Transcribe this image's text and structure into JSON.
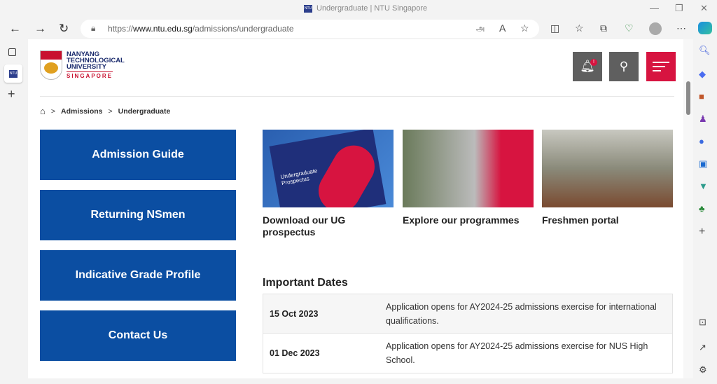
{
  "browser": {
    "tab_title": "Undergraduate | NTU Singapore",
    "url_prefix": "https://",
    "url_domain": "www.ntu.edu.sg",
    "url_path": "/admissions/undergraduate",
    "favicon": "NTU"
  },
  "logo": {
    "line1": "NANYANG",
    "line2": "TECHNOLOGICAL",
    "line3": "UNIVERSITY",
    "line4": "SINGAPORE"
  },
  "header": {
    "notification_badge": "!"
  },
  "breadcrumb": [
    "Admissions",
    "Undergraduate"
  ],
  "sidebar_buttons": [
    "Admission Guide",
    "Returning NSmen",
    "Indicative Grade Profile",
    "Contact Us"
  ],
  "cards": [
    {
      "title": "Download our UG prospectus",
      "image_text": "Undergraduate Prospectus"
    },
    {
      "title": "Explore our programmes"
    },
    {
      "title": "Freshmen portal"
    }
  ],
  "important_dates": {
    "heading": "Important Dates",
    "rows": [
      {
        "date": "15 Oct 2023",
        "text": "Application opens for AY2024-25 admissions exercise for international qualifications."
      },
      {
        "date": "01 Dec 2023",
        "text": "Application opens for AY2024-25 admissions exercise for NUS High School."
      }
    ]
  },
  "colors": {
    "primary": "#0b4ea2",
    "accent": "#d71440",
    "header_btn": "#5f5f5f"
  }
}
